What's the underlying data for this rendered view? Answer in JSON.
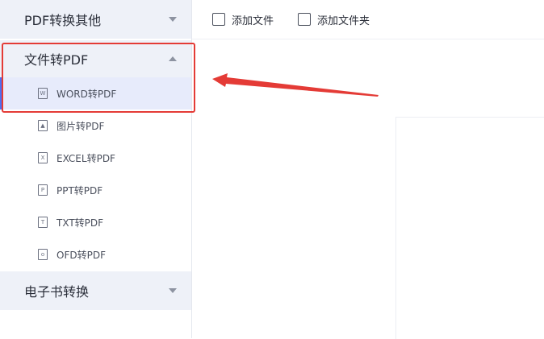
{
  "sidebar": {
    "sections": [
      {
        "title": "PDF转换其他",
        "expanded": false
      },
      {
        "title": "文件转PDF",
        "expanded": true
      },
      {
        "title": "电子书转换",
        "expanded": false
      }
    ],
    "items": [
      {
        "label": "WORD转PDF",
        "icon": "W",
        "active": true
      },
      {
        "label": "图片转PDF",
        "icon": "img"
      },
      {
        "label": "EXCEL转PDF",
        "icon": "X"
      },
      {
        "label": "PPT转PDF",
        "icon": "P"
      },
      {
        "label": "TXT转PDF",
        "icon": "T"
      },
      {
        "label": "OFD转PDF",
        "icon": "O"
      }
    ]
  },
  "toolbar": {
    "add_file_label": "添加文件",
    "add_folder_label": "添加文件夹"
  },
  "colors": {
    "highlight": "#e43b36",
    "accent": "#4e6ef2",
    "sidebar_header_bg": "#eef1f8"
  }
}
